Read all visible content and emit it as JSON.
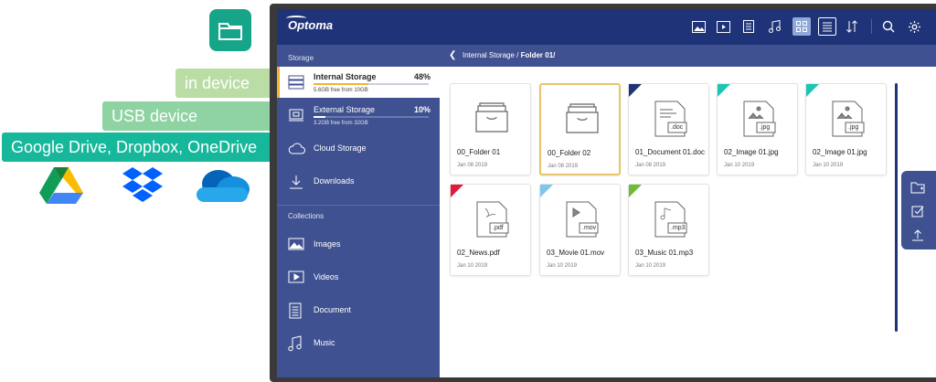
{
  "promo": {
    "app_icon": "folder-icon",
    "tags": [
      "in device",
      "USB device",
      "Google Drive, Dropbox, OneDrive"
    ],
    "logos": [
      "google-drive-logo",
      "dropbox-logo",
      "onedrive-logo"
    ]
  },
  "topbar": {
    "brand": "Optoma",
    "buttons": [
      "image-filter-icon",
      "video-filter-icon",
      "document-filter-icon",
      "music-filter-icon",
      "grid-view-icon",
      "list-view-icon",
      "sort-icon",
      "search-icon",
      "settings-icon"
    ]
  },
  "sidebar": {
    "storage_label": "Storage",
    "internal": {
      "label": "Internal Storage",
      "percent": "48%",
      "usage": 0.48,
      "free": "5.6GB free from 10GB"
    },
    "external": {
      "label": "External Storage",
      "percent": "10%",
      "usage": 0.1,
      "free": "3.2GB free from 32GB"
    },
    "cloud": "Cloud Storage",
    "downloads": "Downloads",
    "collections_label": "Collections",
    "collections": [
      "Images",
      "Videos",
      "Document",
      "Music"
    ]
  },
  "breadcrumb": {
    "path": "Internal Storage / ",
    "current": "Folder 01/"
  },
  "files": [
    {
      "name": "00_Folder 01",
      "date": "Jan 08 2019",
      "type": "folder",
      "ext": "",
      "color": ""
    },
    {
      "name": "00_Folder 02",
      "date": "Jan 08 2019",
      "type": "folder",
      "ext": "",
      "color": "",
      "selected": true
    },
    {
      "name": "01_Document 01.doc",
      "date": "Jan 08 2019",
      "type": "doc",
      "ext": ".doc",
      "color": "#1f3478"
    },
    {
      "name": "02_Image 01.jpg",
      "date": "Jan 10 2019",
      "type": "image",
      "ext": ".jpg",
      "color": "#1cc6b2"
    },
    {
      "name": "02_Image 01.jpg",
      "date": "Jan 10 2019",
      "type": "image",
      "ext": ".jpg",
      "color": "#1cc6b2"
    },
    {
      "name": "02_News.pdf",
      "date": "Jan 10 2019",
      "type": "pdf",
      "ext": ".pdf",
      "color": "#e01b3c"
    },
    {
      "name": "03_Movie 01.mov",
      "date": "Jan 10 2019",
      "type": "video",
      "ext": ".mov",
      "color": "#7fc6ee"
    },
    {
      "name": "03_Music 01.mp3",
      "date": "Jan 10 2019",
      "type": "music",
      "ext": ".mp3",
      "color": "#6dbb36"
    }
  ],
  "side_actions": [
    "new-folder-icon",
    "select-icon",
    "upload-icon"
  ]
}
